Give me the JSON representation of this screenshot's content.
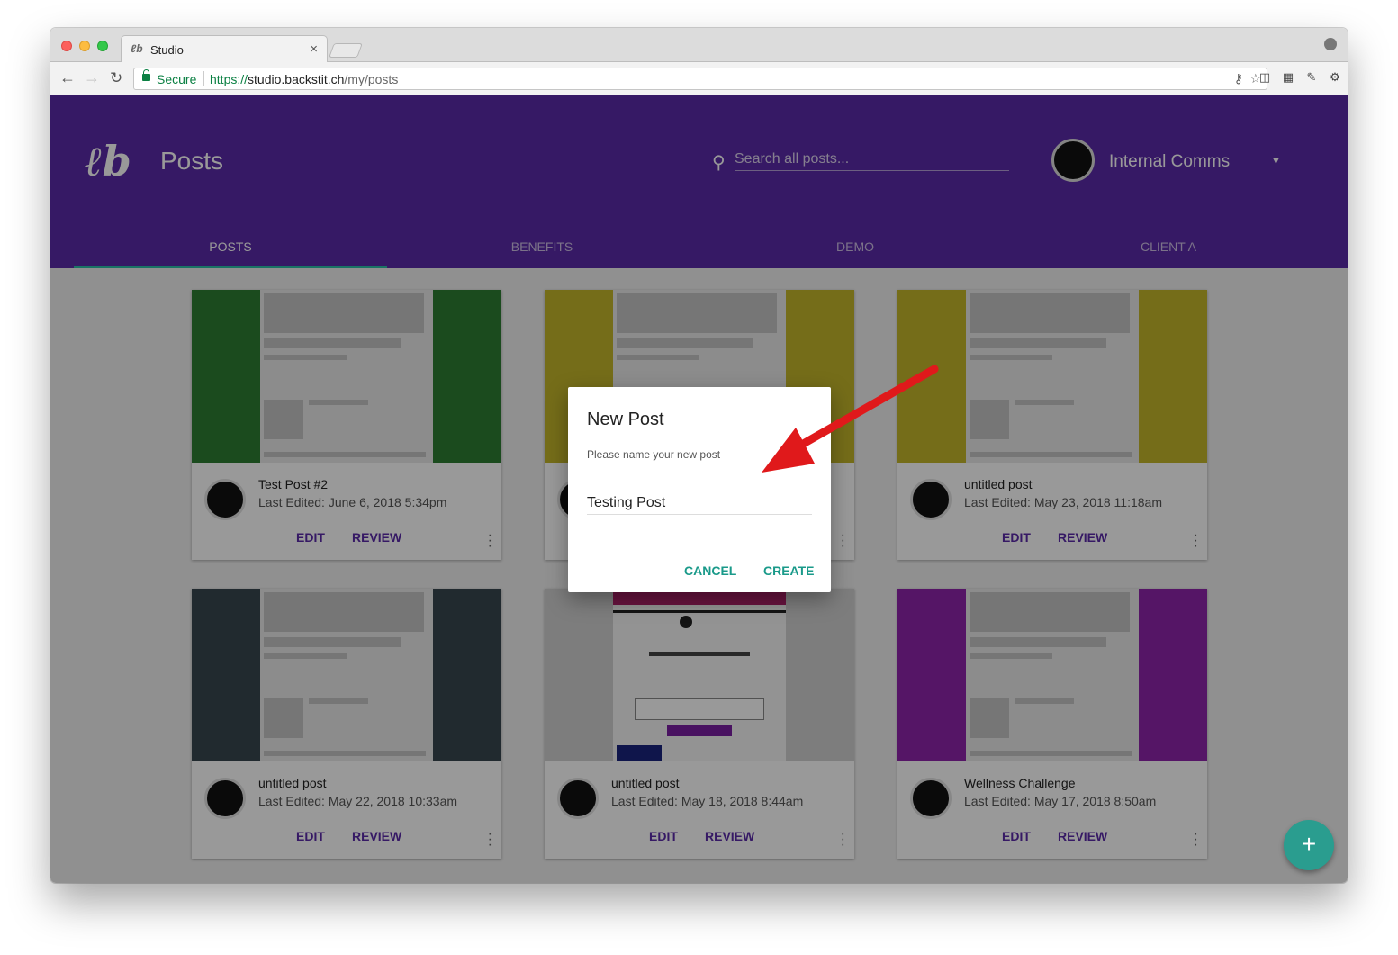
{
  "browser": {
    "tab_title": "Studio",
    "secure_label": "Secure",
    "url_scheme": "https://",
    "url_host": "studio.backstit.ch",
    "url_path": "/my/posts"
  },
  "header": {
    "title": "Posts",
    "search_placeholder": "Search all posts...",
    "org_name": "Internal Comms"
  },
  "tabs": [
    "POSTS",
    "BENEFITS",
    "DEMO",
    "CLIENT A"
  ],
  "cards": [
    {
      "title": "Test Post #2",
      "meta": "Last Edited: June 6, 2018 5:34pm",
      "color": "#2e7d32"
    },
    {
      "title": "",
      "meta": "",
      "color": "#c4b62a"
    },
    {
      "title": "untitled post",
      "meta": "Last Edited: May 23, 2018 11:18am",
      "color": "#c4b62a"
    },
    {
      "title": "untitled post",
      "meta": "Last Edited: May 22, 2018 10:33am",
      "color": "#37474f"
    },
    {
      "title": "untitled post",
      "meta": "Last Edited: May 18, 2018 8:44am",
      "color": "#c8c8c8"
    },
    {
      "title": "Wellness Challenge",
      "meta": "Last Edited: May 17, 2018 8:50am",
      "color": "#8e24aa"
    }
  ],
  "card_actions": {
    "edit": "EDIT",
    "review": "REVIEW"
  },
  "dialog": {
    "title": "New Post",
    "label": "Please name your new post",
    "input_value": "Testing Post",
    "cancel": "CANCEL",
    "create": "CREATE"
  },
  "fab_label": "+",
  "colors": {
    "brand": "#5b2ba8",
    "accent": "#2a9d8f"
  }
}
